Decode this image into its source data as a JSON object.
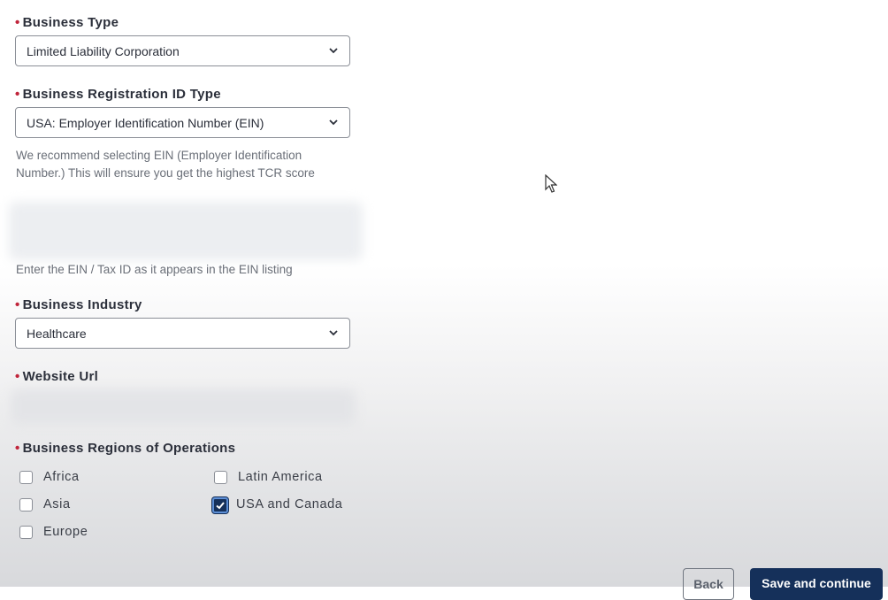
{
  "business_type": {
    "label": "Business Type",
    "value": "Limited Liability Corporation"
  },
  "registration_id_type": {
    "label": "Business Registration ID Type",
    "value": "USA: Employer Identification Number (EIN)",
    "help_line1": "We recommend selecting EIN (Employer Identification",
    "help_line2": "Number.) This will ensure you get the highest TCR score"
  },
  "ein_field": {
    "help": "Enter the EIN / Tax ID as it appears in the EIN listing"
  },
  "business_industry": {
    "label": "Business Industry",
    "value": "Healthcare"
  },
  "website_url": {
    "label": "Website Url"
  },
  "regions": {
    "label": "Business Regions of Operations",
    "options": [
      {
        "label": "Africa",
        "checked": false
      },
      {
        "label": "Latin America",
        "checked": false
      },
      {
        "label": "Asia",
        "checked": false
      },
      {
        "label": "USA and Canada",
        "checked": true
      },
      {
        "label": "Europe",
        "checked": false
      }
    ]
  },
  "actions": {
    "back": "Back",
    "save": "Save and continue"
  },
  "colors": {
    "required": "#c0243a",
    "primary": "#15305a",
    "checkbox_focus": "#5d8fd6"
  }
}
